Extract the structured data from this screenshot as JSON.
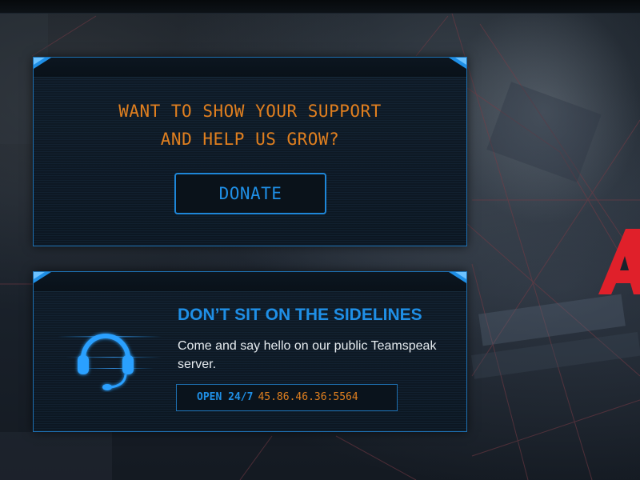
{
  "colors": {
    "accent_blue": "#1f8fe6",
    "accent_orange": "#e07f1f",
    "brand_red": "#e0202a",
    "panel_bg": "#0f1b27",
    "panel_border": "#1d6fb0"
  },
  "support_panel": {
    "line1": "WANT TO SHOW YOUR SUPPORT",
    "line2": "AND HELP US GROW?",
    "donate_label": "DONATE"
  },
  "teamspeak_panel": {
    "icon": "headset-icon",
    "title": "DON’T SIT ON THE SIDELINES",
    "description": "Come and say hello on our public Teamspeak server.",
    "open_label": "OPEN 24/7",
    "server_address": "45.86.46.36:5564"
  },
  "background": {
    "logo_icon": "brand-logo-fragment-icon"
  }
}
